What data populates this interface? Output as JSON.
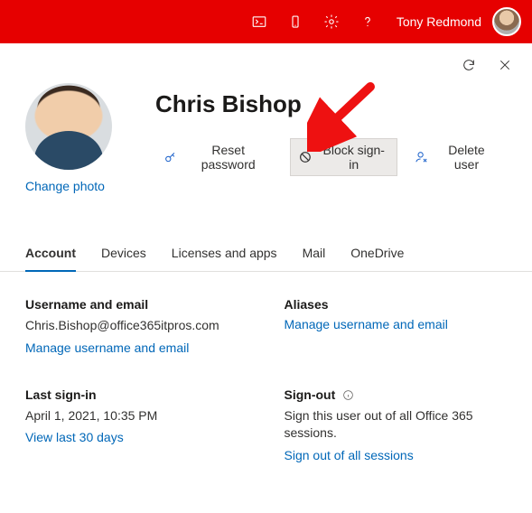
{
  "topbar": {
    "user_name": "Tony Redmond"
  },
  "panel": {
    "display_name": "Chris Bishop",
    "change_photo": "Change photo"
  },
  "actions": {
    "reset": "Reset password",
    "block": "Block sign-in",
    "delete": "Delete user"
  },
  "tabs": {
    "account": "Account",
    "devices": "Devices",
    "licenses": "Licenses and apps",
    "mail": "Mail",
    "onedrive": "OneDrive"
  },
  "account": {
    "username_heading": "Username and email",
    "username_value": "Chris.Bishop@office365itpros.com",
    "username_link": "Manage username and email",
    "aliases_heading": "Aliases",
    "aliases_link": "Manage username and email",
    "lastsignin_heading": "Last sign-in",
    "lastsignin_value": "April 1, 2021, 10:35 PM",
    "lastsignin_link": "View last 30 days",
    "signout_heading": "Sign-out",
    "signout_desc": "Sign this user out of all Office 365 sessions.",
    "signout_link": "Sign out of all sessions"
  }
}
